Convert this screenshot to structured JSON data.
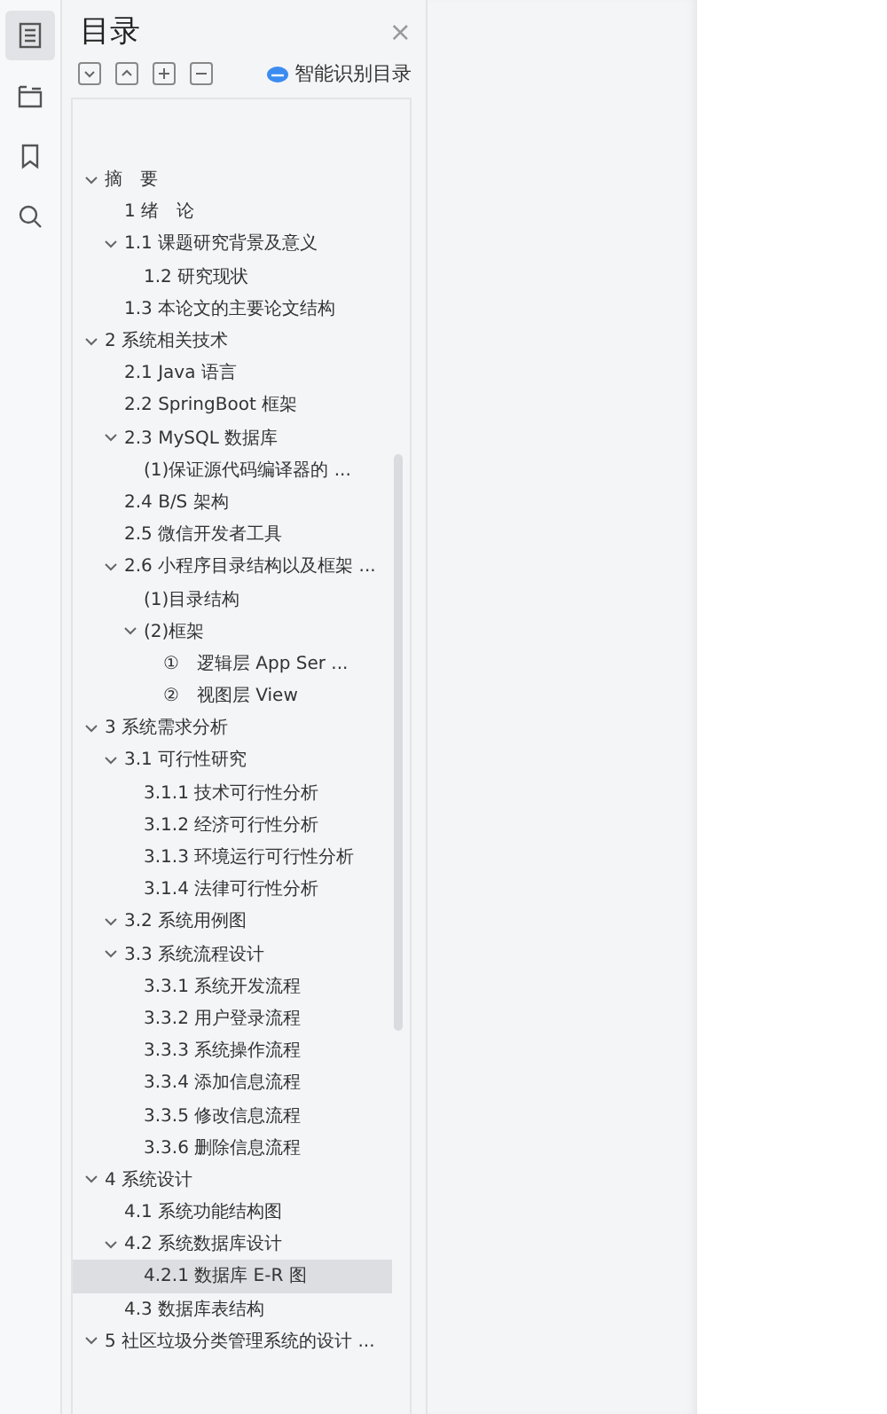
{
  "rail": [
    {
      "kind": "outline",
      "selected": true
    },
    {
      "kind": "layers",
      "selected": false
    },
    {
      "kind": "bookmark",
      "selected": false
    },
    {
      "kind": "search",
      "selected": false
    }
  ],
  "panel": {
    "title": "目录",
    "close": "×",
    "smart_button": "智能识别目录"
  },
  "toolbar": [
    {
      "kind": "expand"
    },
    {
      "kind": "collapse"
    },
    {
      "kind": "add"
    },
    {
      "kind": "remove"
    }
  ],
  "tree": [
    {
      "label": "摘　要",
      "selected": false,
      "expanded": true,
      "children": [
        {
          "label": "1 绪　论",
          "selected": false
        },
        {
          "label": "1.1 课题研究背景及意义",
          "selected": false,
          "expanded": true,
          "children": [
            {
              "label": "1.2 研究现状",
              "selected": false
            }
          ]
        },
        {
          "label": "1.3 本论文的主要论文结构",
          "selected": false
        }
      ]
    },
    {
      "label": "2 系统相关技术",
      "selected": false,
      "expanded": true,
      "children": [
        {
          "label": "2.1 Java 语言",
          "selected": false
        },
        {
          "label": "2.2 SpringBoot 框架",
          "selected": false
        },
        {
          "label": "2.3 MySQL 数据库",
          "selected": false,
          "expanded": true,
          "children": [
            {
              "label": "(1)保证源代码编译器的 ...",
              "selected": false
            }
          ]
        },
        {
          "label": "2.4 B/S 架构",
          "selected": false
        },
        {
          "label": "2.5  微信开发者工具",
          "selected": false
        },
        {
          "label": "2.6  小程序目录结构以及框架 ...",
          "selected": false,
          "expanded": true,
          "children": [
            {
              "label": "(1)目录结构",
              "selected": false
            },
            {
              "label": "(2)框架",
              "selected": false,
              "expanded": true,
              "children": [
                {
                  "label": "①　逻辑层  App Ser ...",
                  "selected": false
                },
                {
                  "label": "②　视图层  View",
                  "selected": false
                }
              ]
            }
          ]
        }
      ]
    },
    {
      "label": "3 系统需求分析",
      "selected": false,
      "expanded": true,
      "children": [
        {
          "label": "3.1 可行性研究",
          "selected": false,
          "expanded": true,
          "children": [
            {
              "label": "3.1.1 技术可行性分析",
              "selected": false
            },
            {
              "label": "3.1.2  经济可行性分析",
              "selected": false
            },
            {
              "label": "3.1.3  环境运行可行性分析",
              "selected": false
            },
            {
              "label": "3.1.4  法律可行性分析",
              "selected": false
            }
          ]
        },
        {
          "label": "3.2 系统用例图",
          "selected": false,
          "expanded": true
        },
        {
          "label": "3.3 系统流程设计",
          "selected": false,
          "expanded": true,
          "children": [
            {
              "label": "3.3.1  系统开发流程",
              "selected": false
            },
            {
              "label": "3.3.2  用户登录流程",
              "selected": false
            },
            {
              "label": "3.3.3  系统操作流程",
              "selected": false
            },
            {
              "label": "3.3.4  添加信息流程",
              "selected": false
            },
            {
              "label": "3.3.5  修改信息流程",
              "selected": false
            },
            {
              "label": "3.3.6  删除信息流程",
              "selected": false
            }
          ]
        }
      ]
    },
    {
      "label": "4 系统设计",
      "selected": false,
      "expanded": true,
      "children": [
        {
          "label": "4.1 系统功能结构图",
          "selected": false
        },
        {
          "label": "4.2 系统数据库设计",
          "selected": false,
          "expanded": true,
          "children": [
            {
              "label": "4.2.1 数据库 E-R 图",
              "selected": true
            }
          ]
        },
        {
          "label": "4.3 数据库表结构",
          "selected": false
        }
      ]
    },
    {
      "label": "5 社区垃圾分类管理系统的设计 ...",
      "selected": false,
      "expanded": true
    }
  ]
}
